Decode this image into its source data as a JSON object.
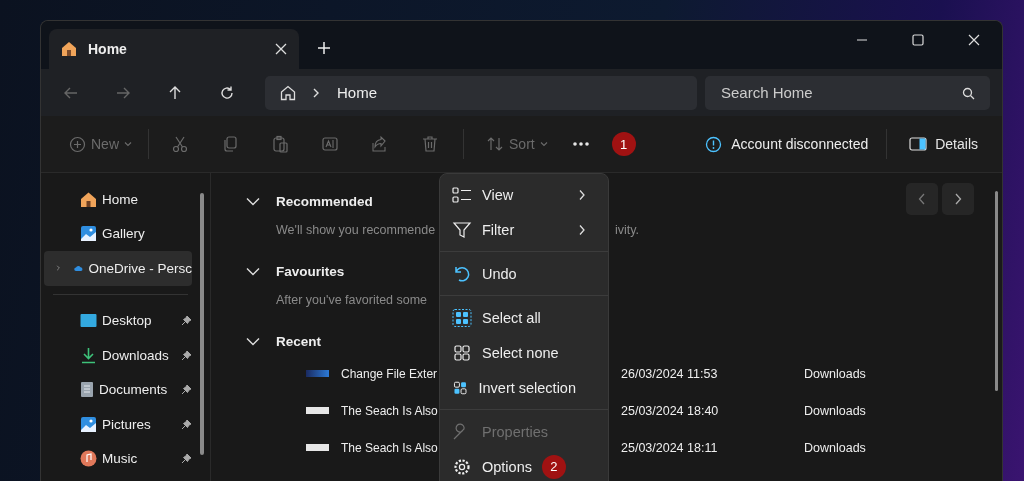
{
  "window": {
    "tab": {
      "title": "Home"
    }
  },
  "nav": {
    "back_disabled": true,
    "forward_disabled": true,
    "path": "Home",
    "search": {
      "placeholder": "Search Home"
    }
  },
  "toolbar": {
    "actions": [
      {
        "kind": "new",
        "label": "New",
        "disabled": true
      },
      {
        "kind": "cut",
        "disabled": true
      },
      {
        "kind": "copy",
        "disabled": true
      },
      {
        "kind": "paste",
        "disabled": true
      },
      {
        "kind": "rename",
        "disabled": true
      },
      {
        "kind": "share",
        "disabled": true
      },
      {
        "kind": "delete",
        "disabled": true
      },
      {
        "kind": "sort",
        "label": "Sort",
        "disabled": true
      },
      {
        "kind": "more",
        "disabled": false,
        "annotation": "1"
      }
    ],
    "account": "Account disconnected",
    "details": "Details"
  },
  "sidebar": {
    "items": [
      {
        "kind": "home",
        "label": "Home",
        "selected": false,
        "expandable": false,
        "pinned": false
      },
      {
        "kind": "gallery",
        "label": "Gallery",
        "selected": false,
        "expandable": false,
        "pinned": false
      },
      {
        "kind": "cloud",
        "label": "OneDrive - Persc",
        "selected": true,
        "expandable": true,
        "pinned": false
      },
      {
        "kind": "divider"
      },
      {
        "kind": "desktop",
        "label": "Desktop",
        "selected": false,
        "expandable": false,
        "pinned": true
      },
      {
        "kind": "downloads",
        "label": "Downloads",
        "selected": false,
        "expandable": false,
        "pinned": true
      },
      {
        "kind": "documents",
        "label": "Documents",
        "selected": false,
        "expandable": false,
        "pinned": true
      },
      {
        "kind": "pictures",
        "label": "Pictures",
        "selected": false,
        "expandable": false,
        "pinned": true
      },
      {
        "kind": "music",
        "label": "Music",
        "selected": false,
        "expandable": false,
        "pinned": true
      }
    ]
  },
  "sections": [
    {
      "title": "Recommended",
      "expanded": true,
      "hint": "We'll show you recommende",
      "hint_tail": "ivity."
    },
    {
      "title": "Favourites",
      "expanded": true,
      "hint": "After you've favorited some"
    },
    {
      "title": "Recent",
      "expanded": true,
      "rows": [
        {
          "kind": "blue",
          "name": "Change File Exter",
          "date": "26/03/2024 11:53",
          "location": "Downloads"
        },
        {
          "kind": "white",
          "name": "The Seach Is Also",
          "date": "25/03/2024 18:40",
          "location": "Downloads"
        },
        {
          "kind": "white",
          "name": "The Seach Is Also",
          "date": "25/03/2024 18:11",
          "location": "Downloads"
        }
      ]
    }
  ],
  "menu": {
    "groups": [
      [
        {
          "kind": "view",
          "label": "View",
          "submenu": true,
          "disabled": false
        },
        {
          "kind": "filter",
          "label": "Filter",
          "submenu": true,
          "disabled": false
        }
      ],
      [
        {
          "kind": "undo",
          "label": "Undo",
          "submenu": false,
          "disabled": false
        }
      ],
      [
        {
          "kind": "selectall",
          "label": "Select all",
          "submenu": false,
          "disabled": false
        },
        {
          "kind": "selectnone",
          "label": "Select none",
          "submenu": false,
          "disabled": false
        },
        {
          "kind": "invert",
          "label": "Invert selection",
          "submenu": false,
          "disabled": false
        }
      ],
      [
        {
          "kind": "properties",
          "label": "Properties",
          "submenu": false,
          "disabled": true
        },
        {
          "kind": "options",
          "label": "Options",
          "submenu": false,
          "disabled": false,
          "annotation": "2"
        }
      ]
    ]
  }
}
